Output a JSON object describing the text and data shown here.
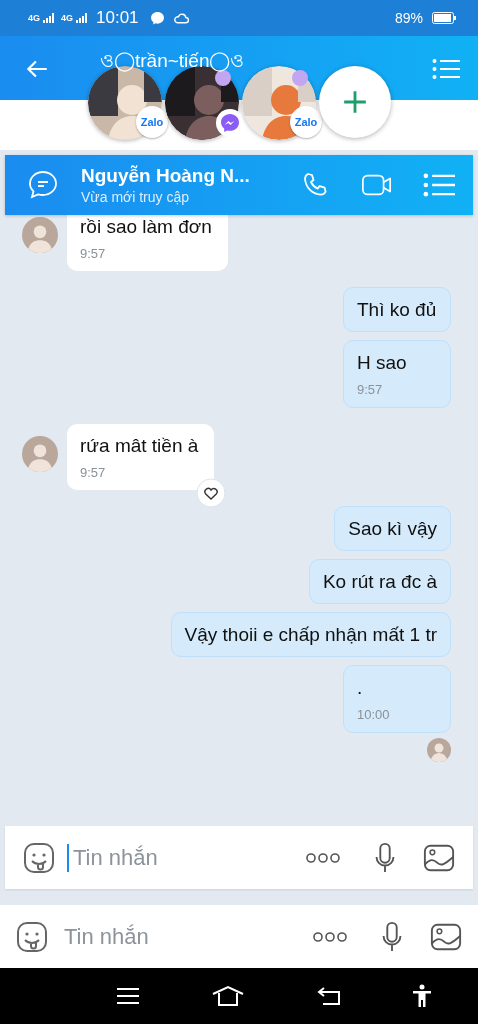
{
  "status_bar": {
    "network_1": "4G",
    "network_2": "4G",
    "time": "10:01",
    "battery": "89%"
  },
  "header": {
    "title": "ও◯trần~tiến◯ও"
  },
  "bubble_heads": [
    {
      "kind": "zalo",
      "badge_text": "Zalo",
      "dot": false
    },
    {
      "kind": "messenger",
      "dot": true
    },
    {
      "kind": "zalo",
      "badge_text": "Zalo",
      "dot": true
    }
  ],
  "chat_header": {
    "name": "Nguyễn Hoàng N...",
    "status": "Vừa mới truy cập"
  },
  "messages": [
    {
      "kind": "incoming",
      "text": "rồi sao làm đơn",
      "time": "9:57",
      "avatar": true
    },
    {
      "kind": "outgoing",
      "text": "Thì ko đủ"
    },
    {
      "kind": "outgoing",
      "text": "H sao",
      "time": "9:57"
    },
    {
      "kind": "incoming",
      "text": "rứa mât tiền à",
      "time": "9:57",
      "avatar": true,
      "hearted": true
    },
    {
      "kind": "outgoing",
      "text": "Sao kì vậy"
    },
    {
      "kind": "outgoing",
      "text": "Ko rút ra đc à"
    },
    {
      "kind": "outgoing",
      "text": "Vậy thoii e chấp nhận mất 1 tr"
    },
    {
      "kind": "outgoing",
      "text": ".",
      "time": "10:00"
    }
  ],
  "seen": true,
  "composer": {
    "placeholder": "Tin nhắn",
    "focused": true
  },
  "composer_back": {
    "placeholder": "Tin nhắn"
  }
}
